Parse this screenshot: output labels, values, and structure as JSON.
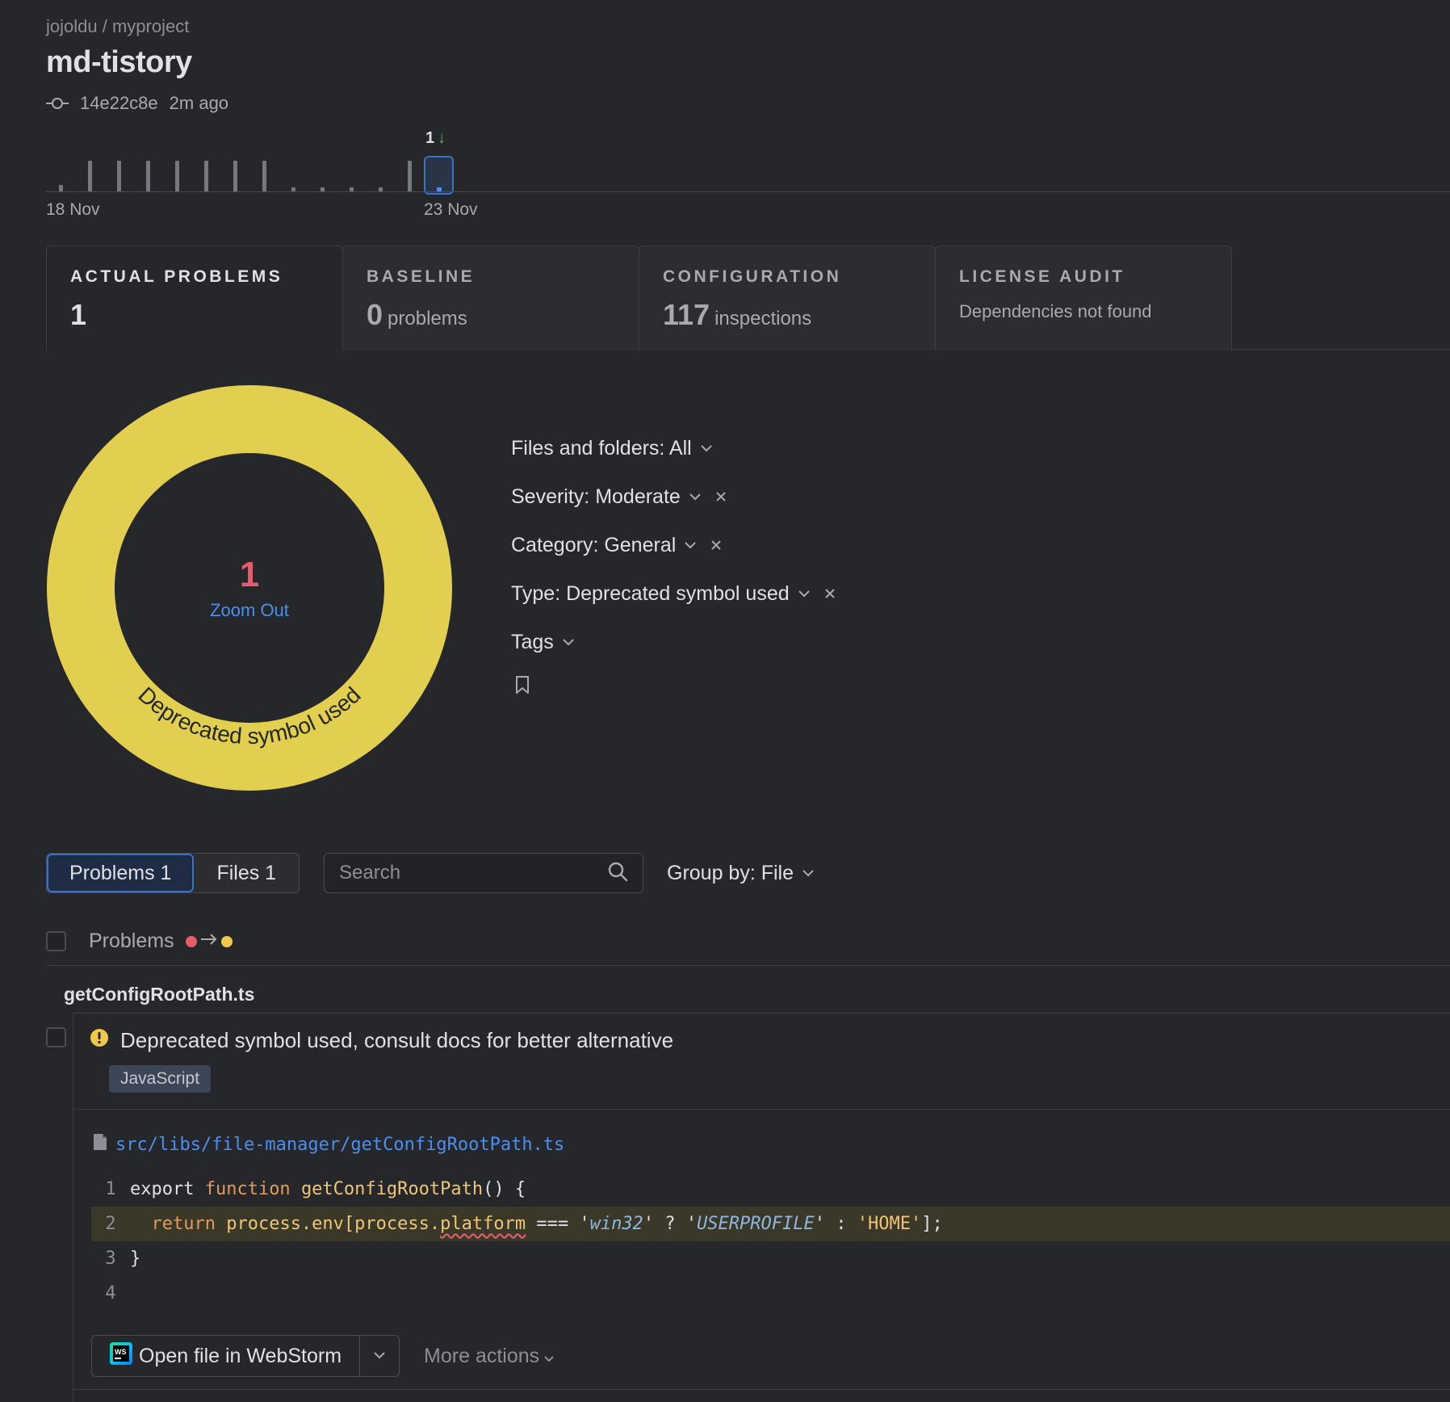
{
  "header": {
    "breadcrumb": "jojoldu / myproject",
    "title": "md-tistory",
    "commit_hash": "14e22c8e",
    "commit_time": "2m ago"
  },
  "timeline": {
    "selected_count": "1",
    "selected_trend_icon": "arrow-down-icon",
    "start_label": "18 Nov",
    "end_label": "23 Nov"
  },
  "tabs": [
    {
      "label": "ACTUAL PROBLEMS",
      "value": "1",
      "unit": ""
    },
    {
      "label": "BASELINE",
      "value": "0",
      "unit": "problems"
    },
    {
      "label": "CONFIGURATION",
      "value": "117",
      "unit": "inspections"
    },
    {
      "label": "LICENSE AUDIT",
      "sub": "Dependencies not found"
    }
  ],
  "donut": {
    "count": "1",
    "zoom_label": "Zoom Out",
    "segment_label": "Deprecated symbol used",
    "segment_color": "#e3cf4f"
  },
  "filters": {
    "files": "Files and folders: All",
    "severity": "Severity: Moderate",
    "category": "Category: General",
    "type": "Type: Deprecated symbol used",
    "tags": "Tags"
  },
  "toolbar": {
    "problems_tab": "Problems 1",
    "files_tab": "Files 1",
    "search_placeholder": "Search",
    "group_by": "Group by: File"
  },
  "list": {
    "header_label": "Problems",
    "severity_from_color": "#e35d6a",
    "severity_to_color": "#f0c94a"
  },
  "problem": {
    "file_name": "getConfigRootPath.ts",
    "message": "Deprecated symbol used, consult docs for better alternative",
    "language": "JavaScript",
    "path": "src/libs/file-manager/getConfigRootPath.ts",
    "code": {
      "l1": {
        "num": "1",
        "export": "export ",
        "function": "function ",
        "name": "getConfigRootPath",
        "rest": "() {"
      },
      "l2": {
        "num": "2",
        "indent": "  ",
        "ret": "return ",
        "expr1": "process.env[process.",
        "squig": "platform",
        "op": " === ",
        "q1": "'",
        "win": "win32",
        "q2": "'",
        "tern": " ? ",
        "q3": "'",
        "up": "USERPROFILE",
        "q4": "'",
        "colon": " : ",
        "home": "'HOME'",
        "end": "];"
      },
      "l3": {
        "num": "3",
        "text": "}"
      },
      "l4": {
        "num": "4",
        "text": ""
      }
    },
    "open_button": "Open file in WebStorm",
    "more_actions": "More actions"
  }
}
